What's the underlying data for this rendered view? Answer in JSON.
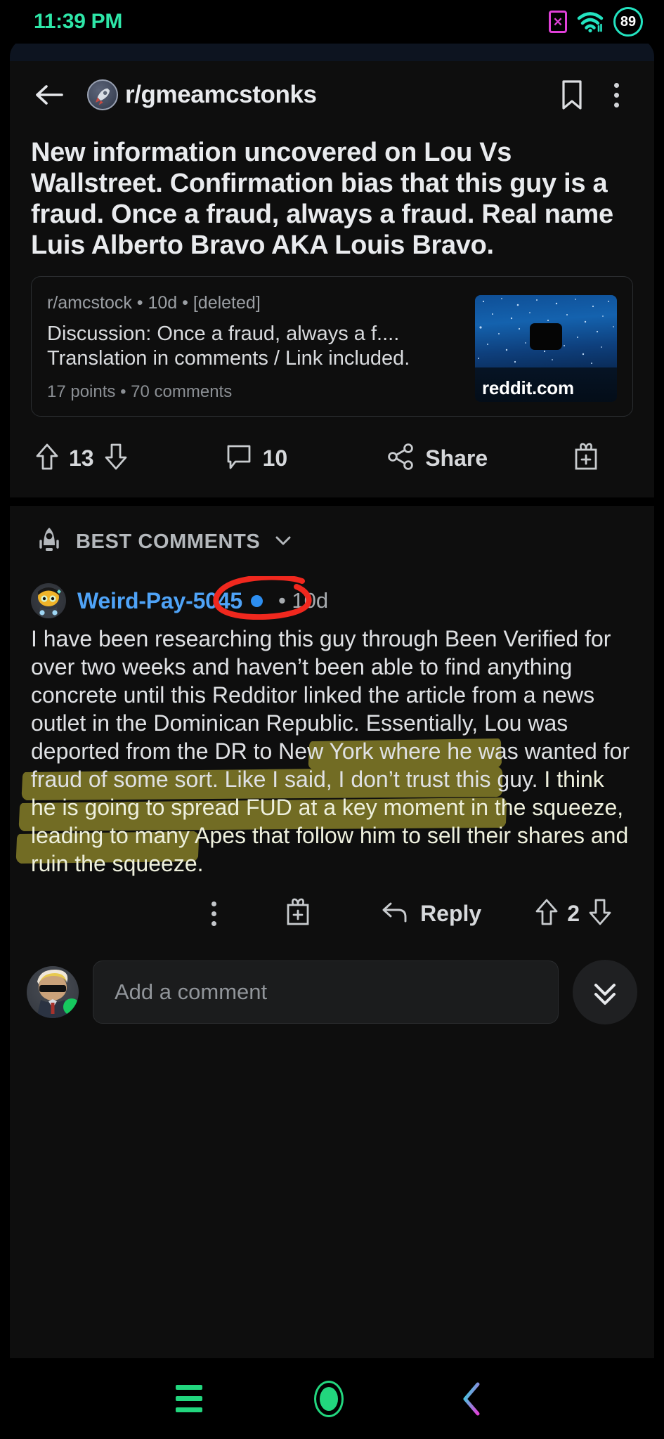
{
  "statusbar": {
    "time": "11:39 PM",
    "sim_icon": "sim-card-x-icon",
    "sim_glyph": "✕",
    "wifi_icon": "wifi-icon",
    "battery_level": "89",
    "clock_color": "#2ee6a8",
    "sim_color": "#e040d8",
    "wifi_color": "#23e3c0",
    "battery_color": "#23e3c0"
  },
  "header": {
    "back_icon": "back-arrow-icon",
    "subreddit_avatar": "rocket-avatar-icon",
    "subreddit": "r/gmeamcstonks",
    "bookmark_icon": "bookmark-icon",
    "overflow_icon": "kebab-menu-icon"
  },
  "post": {
    "title": "New information uncovered on Lou Vs Wallstreet. Confirmation bias that this guy is a fraud. Once a fraud, always a fraud. Real name Luis Alberto Bravo AKA Louis Bravo.",
    "crosspost": {
      "meta": "r/amcstock • 10d • [deleted]",
      "body": "Discussion: Once a fraud, always a f.... Translation in comments / Link included.",
      "points": "17 points • 70 comments",
      "thumbnail_label": "reddit.com",
      "thumbnail_icon": "starry-sky-thumbnail"
    },
    "actions": {
      "upvote_icon": "upvote-arrow-icon",
      "score": "13",
      "downvote_icon": "downvote-arrow-icon",
      "comment_icon": "comment-bubble-icon",
      "comment_count": "10",
      "share_icon": "share-icon",
      "share_label": "Share",
      "award_icon": "award-gift-icon"
    }
  },
  "comments_sort": {
    "icon": "rocket-icon",
    "label": "BEST COMMENTS",
    "chevron": "chevron-down-icon"
  },
  "comment": {
    "avatar": "user-avatar-icon",
    "username": "Weird-Pay-5045",
    "badge": "online-badge-icon",
    "age": "• 10d",
    "body_plain": "I have been researching this guy through Been Verified for over two weeks and haven’t been able to find anything concrete until this Redditor linked the article from a news outlet in the Dominican Republic. Essentially, Lou was deported from the DR to New York where he was wanted for fraud of some sort. Like I said, I don’t trust this guy. ",
    "body_highlighted": "I think he is going to spread FUD at a key moment in the squeeze, leading to many Apes that follow him to sell their shares and ruin the squeeze.",
    "annotation_red_circle": "red-circle-annotation around timestamp",
    "annotation_highlight_color": "#b0a632",
    "actions": {
      "overflow_icon": "kebab-menu-icon",
      "award_icon": "award-gift-icon",
      "reply_icon": "reply-arrow-icon",
      "reply_label": "Reply",
      "upvote_icon": "upvote-arrow-icon",
      "score": "2",
      "downvote_icon": "downvote-arrow-icon"
    }
  },
  "add_comment": {
    "avatar": "my-avatar-icon",
    "online_dot": "online-status-dot",
    "placeholder": "Add a comment",
    "scroll_icon": "double-chevron-down-icon"
  },
  "navbar": {
    "recents_icon": "recents-menu-icon",
    "home_icon": "home-circle-icon",
    "back_icon": "back-chevron-icon",
    "accent_green": "#22d67e",
    "back_gradient_from": "#23e3e0",
    "back_gradient_to": "#e040d8"
  }
}
